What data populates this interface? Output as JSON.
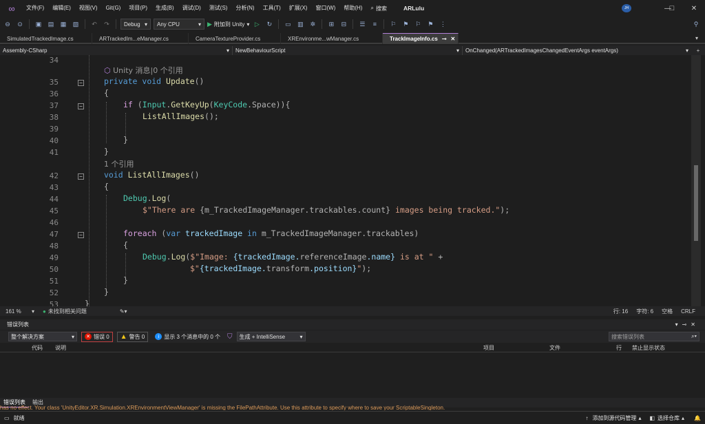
{
  "menu": [
    "文件(F)",
    "编辑(E)",
    "视图(V)",
    "Git(G)",
    "项目(P)",
    "生成(B)",
    "调试(D)",
    "测试(S)",
    "分析(N)",
    "工具(T)",
    "扩展(X)",
    "窗口(W)",
    "帮助(H)"
  ],
  "search_label": "搜索",
  "solution_name": "ARLulu",
  "avatar_initials": "JH",
  "toolbar": {
    "config": "Debug",
    "platform": "Any CPU",
    "attach_label": "附加到 Unity"
  },
  "tabs": [
    {
      "label": "SimulatedTrackedImage.cs"
    },
    {
      "label": "ARTrackedIm...eManager.cs"
    },
    {
      "label": "CameraTextureProvider.cs"
    },
    {
      "label": "XREnvironme...wManager.cs"
    },
    {
      "label": "TrackImageInfo.cs"
    }
  ],
  "navbar": {
    "project": "Assembly-CSharp",
    "class": "NewBehaviourScript",
    "member": "OnChanged(ARTrackedImagesChangedEventArgs eventArgs)"
  },
  "editor": {
    "line_numbers": [
      "34",
      "35",
      "36",
      "37",
      "38",
      "39",
      "40",
      "41",
      "42",
      "43",
      "44",
      "45",
      "46",
      "47",
      "48",
      "49",
      "50",
      "51",
      "52",
      "53"
    ],
    "lens_unity": "Unity 消息|0 个引用",
    "lens_refs": "1 个引用",
    "code": {
      "l35_a": "private",
      "l35_b": "void",
      "l35_c": "Update",
      "l35_d": "()",
      "l36": "{",
      "l37_a": "if",
      "l37_b": " (",
      "l37_c": "Input",
      "l37_d": ".",
      "l37_e": "GetKeyUp",
      "l37_f": "(",
      "l37_g": "KeyCode",
      "l37_h": ".Space)){",
      "l38_a": "ListAllImages",
      "l38_b": "();",
      "l40": "}",
      "l41": "}",
      "l42_a": "void",
      "l42_b": "ListAllImages",
      "l42_c": "()",
      "l43": "{",
      "l44_a": "Debug",
      "l44_b": ".",
      "l44_c": "Log",
      "l44_d": "(",
      "l45_a": "$\"There are ",
      "l45_b": "{m_TrackedImageManager.trackables.count}",
      "l45_c": " images being tracked.\"",
      "l45_d": ");",
      "l47_a": "foreach",
      "l47_b": " (",
      "l47_c": "var",
      "l47_d": " trackedImage ",
      "l47_e": "in",
      "l47_f": " m_TrackedImageManager.trackables)",
      "l48": "{",
      "l49_a": "Debug",
      "l49_b": ".",
      "l49_c": "Log",
      "l49_d": "(",
      "l49_e": "$\"Image: ",
      "l49_f": "{trackedImage.",
      "l49_g": "referenceImage",
      "l49_h": ".name}",
      "l49_i": " is at \"",
      "l49_j": " +",
      "l50_a": "$\"",
      "l50_b": "{trackedImage.",
      "l50_c": "transform",
      "l50_d": ".position}",
      "l50_e": "\"",
      "l50_f": ");",
      "l51": "}",
      "l52": "}",
      "l53": "}"
    }
  },
  "edstatus": {
    "zoom": "161 %",
    "issues": "未找到相关问题",
    "line": "行: 16",
    "char": "字符: 6",
    "spaces": "空格",
    "eol": "CRLF"
  },
  "errorlist": {
    "title": "错误列表",
    "scope": "整个解决方案",
    "errors": "错误 0",
    "warnings": "警告 0",
    "messages": "显示 3 个消息中的 0 个",
    "build_filter": "生成 + IntelliSense",
    "search_placeholder": "搜索错误列表",
    "columns": [
      "代码",
      "说明",
      "项目",
      "文件",
      "行",
      "禁止显示状态"
    ],
    "tabs": [
      "错误列表",
      "输出"
    ]
  },
  "statusbar": {
    "ready": "就绪",
    "add_source": "添加到源代码管理",
    "select_repo": "选择仓库",
    "ghost_text": "has no effect. Your class 'UnityEditor.XR.Simulation.XREnvironmentViewManager' is missing the FilePathAttribute. Use this attribute to specify where to save your ScriptableSingleton."
  }
}
